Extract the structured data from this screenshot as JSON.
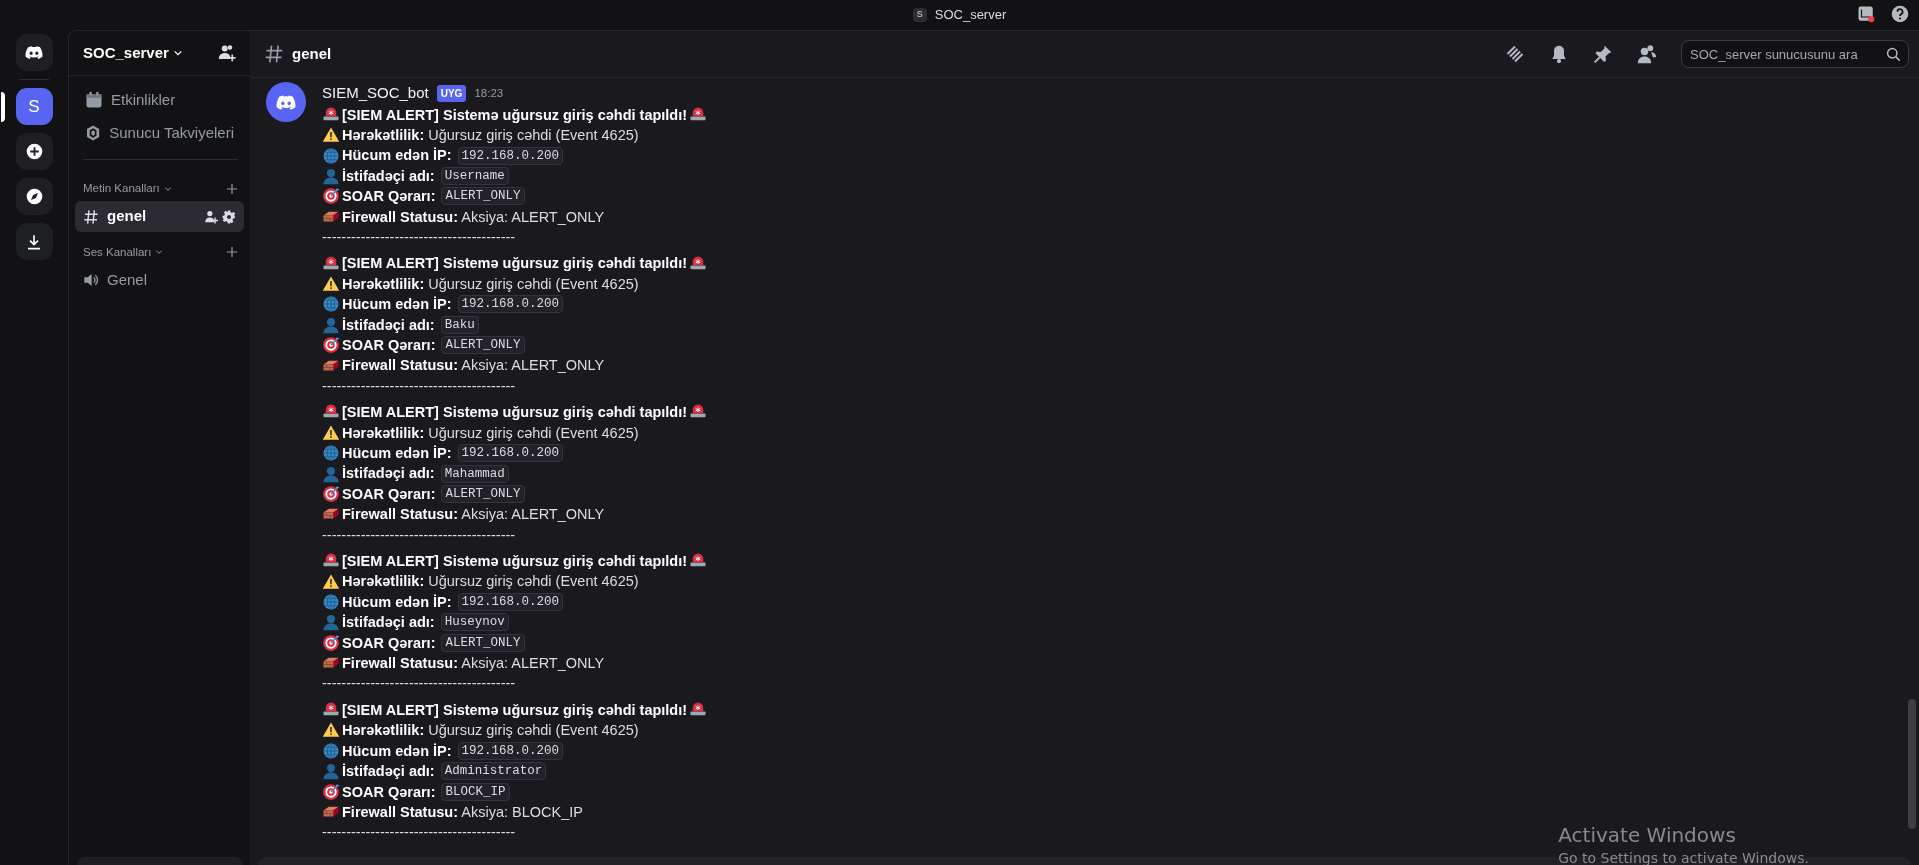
{
  "title_bar": {
    "server_initial": "S",
    "title": "SOC_server"
  },
  "rail": {
    "servers": [
      {
        "label": "S",
        "selected": true
      }
    ]
  },
  "sidebar": {
    "server_name": "SOC_server",
    "links": [
      "Etkinlikler",
      "Sunucu Takviyeleri"
    ],
    "categories": [
      {
        "label": "Metin Kanalları",
        "kind": "text",
        "channels": [
          {
            "label": "genel",
            "selected": true
          }
        ]
      },
      {
        "label": "Ses Kanalları",
        "kind": "voice",
        "channels": [
          {
            "label": "Genel",
            "selected": false
          }
        ]
      }
    ]
  },
  "header": {
    "channel": "genel",
    "search": {
      "placeholder": "SOC_server sunucusunu ara"
    }
  },
  "message": {
    "author": "SIEM_SOC_bot",
    "badge": "UYG",
    "time": "18:23",
    "alerts": [
      {
        "title": "[SIEM ALERT] Sistemə uğursuz giriş cəhdi tapıldı!",
        "lines": [
          {
            "kind": "text",
            "text": "**Hərəkətlilik:** Uğursuz giriş cəhdi (Event 4625)"
          },
          {
            "kind": "code",
            "label": "Hücum edən İP:",
            "value": "192.168.0.200"
          },
          {
            "kind": "code",
            "label": "İstifadəçi adı:",
            "value": "Username"
          },
          {
            "kind": "code",
            "label": "SOAR Qərarı:",
            "value": "ALERT_ONLY"
          },
          {
            "kind": "text",
            "text": "**Firewall Statusu:** Aksiya: ALERT_ONLY"
          }
        ],
        "separator": "----------------------------------------"
      },
      {
        "title": "[SIEM ALERT] Sistemə uğursuz giriş cəhdi tapıldı!",
        "lines": [
          {
            "kind": "text",
            "text": "**Hərəkətlilik:** Uğursuz giriş cəhdi (Event 4625)"
          },
          {
            "kind": "code",
            "label": "Hücum edən İP:",
            "value": "192.168.0.200"
          },
          {
            "kind": "code",
            "label": "İstifadəçi adı:",
            "value": "Baku"
          },
          {
            "kind": "code",
            "label": "SOAR Qərarı:",
            "value": "ALERT_ONLY"
          },
          {
            "kind": "text",
            "text": "**Firewall Statusu:** Aksiya: ALERT_ONLY"
          }
        ],
        "separator": "----------------------------------------"
      },
      {
        "title": "[SIEM ALERT] Sistemə uğursuz giriş cəhdi tapıldı!",
        "lines": [
          {
            "kind": "text",
            "text": "**Hərəkətlilik:** Uğursuz giriş cəhdi (Event 4625)"
          },
          {
            "kind": "code",
            "label": "Hücum edən İP:",
            "value": "192.168.0.200"
          },
          {
            "kind": "code",
            "label": "İstifadəçi adı:",
            "value": "Mahammad"
          },
          {
            "kind": "code",
            "label": "SOAR Qərarı:",
            "value": "ALERT_ONLY"
          },
          {
            "kind": "text",
            "text": "**Firewall Statusu:** Aksiya: ALERT_ONLY"
          }
        ],
        "separator": "----------------------------------------"
      },
      {
        "title": "[SIEM ALERT] Sistemə uğursuz giriş cəhdi tapıldı!",
        "lines": [
          {
            "kind": "text",
            "text": "**Hərəkətlilik:** Uğursuz giriş cəhdi (Event 4625)"
          },
          {
            "kind": "code",
            "label": "Hücum edən İP:",
            "value": "192.168.0.200"
          },
          {
            "kind": "code",
            "label": "İstifadəçi adı:",
            "value": "Huseynov"
          },
          {
            "kind": "code",
            "label": "SOAR Qərarı:",
            "value": "ALERT_ONLY"
          },
          {
            "kind": "text",
            "text": "**Firewall Statusu:** Aksiya: ALERT_ONLY"
          }
        ],
        "separator": "----------------------------------------"
      },
      {
        "title": "[SIEM ALERT] Sistemə uğursuz giriş cəhdi tapıldı!",
        "lines": [
          {
            "kind": "text",
            "text": "**Hərəkətlilik:** Uğursuz giriş cəhdi (Event 4625)"
          },
          {
            "kind": "code",
            "label": "Hücum edən İP:",
            "value": "192.168.0.200"
          },
          {
            "kind": "code",
            "label": "İstifadəçi adı:",
            "value": "Administrator"
          },
          {
            "kind": "code",
            "label": "SOAR Qərarı:",
            "value": "BLOCK_IP"
          },
          {
            "kind": "text",
            "text": "**Firewall Statusu:** Aksiya: BLOCK_IP"
          }
        ],
        "separator": "----------------------------------------"
      }
    ]
  },
  "os_notice": {
    "title": "Activate Windows",
    "text": "Go to Settings to activate Windows."
  }
}
